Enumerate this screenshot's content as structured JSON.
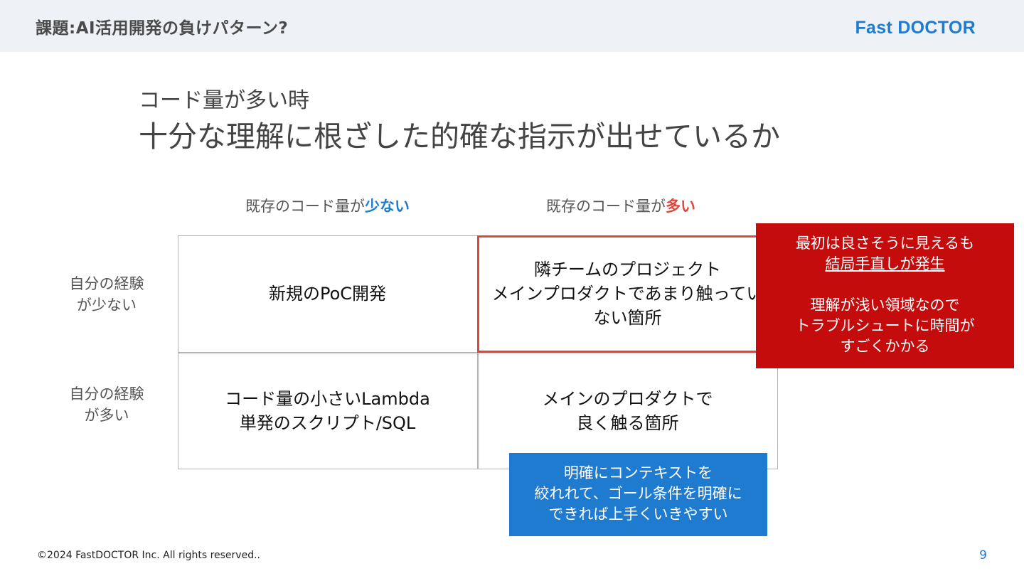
{
  "header": {
    "title": "課題:AI活用開発の負けパターン?",
    "brand": "Fast DOCTOR"
  },
  "slide": {
    "subtitle": "コード量が多い時",
    "title": "十分な理解に根ざした的確な指示が出せているか"
  },
  "matrix": {
    "columns": [
      {
        "prefix": "既存のコード量が",
        "emphasis": "少ない",
        "emphasis_color": "#1f7bd0"
      },
      {
        "prefix": "既存のコード量が",
        "emphasis": "多い",
        "emphasis_color": "#e0463c"
      }
    ],
    "rows": [
      {
        "line1": "自分の経験",
        "line2": "が少ない"
      },
      {
        "line1": "自分の経験",
        "line2": "が多い"
      }
    ],
    "cells": {
      "top_left": [
        "新規のPoC開発"
      ],
      "top_right": [
        "隣チームのプロジェクト",
        "メインプロダクトであまり触ってい",
        "ない箇所"
      ],
      "bottom_left": [
        "コード量の小さいLambda",
        "単発のスクリプト/SQL"
      ],
      "bottom_right": [
        "メインのプロダクトで",
        "良く触る箇所"
      ]
    }
  },
  "callouts": {
    "red": {
      "line1": "最初は良さそうに見えるも",
      "line2": "結局手直しが発生",
      "line3": "理解が浅い領域なので",
      "line4": "トラブルシュートに時間が",
      "line5": "すごくかかる",
      "color": "#c50c0c"
    },
    "blue": {
      "line1": "明確にコンテキストを",
      "line2": "絞れれて、ゴール条件を明確に",
      "line3": "できれば上手くいきやすい",
      "color": "#1f7bd0"
    }
  },
  "footer": {
    "copyright": "©2024 FastDOCTOR Inc. All rights reserved..",
    "page_number": "9"
  }
}
